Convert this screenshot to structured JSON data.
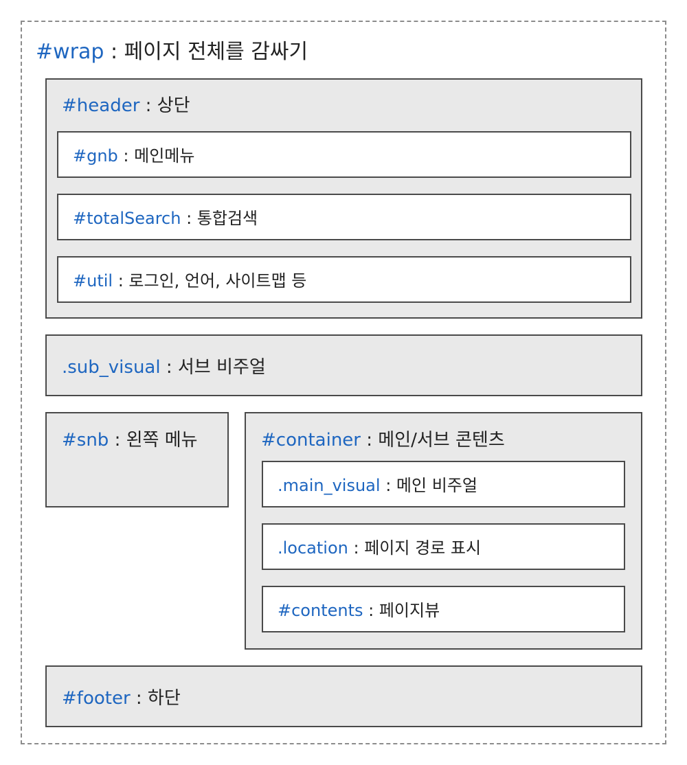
{
  "colors": {
    "selector": "#1e66c0",
    "text": "#222222",
    "section_bg": "#e9e9e9",
    "border": "#4a4a4a",
    "dashed_border": "#8c8c8c"
  },
  "wrap": {
    "selector": "#wrap",
    "desc": " : 페이지 전체를 감싸기"
  },
  "header": {
    "selector": "#header",
    "desc": " : 상단",
    "gnb": {
      "selector": "#gnb",
      "desc": " : 메인메뉴"
    },
    "totalSearch": {
      "selector": "#totalSearch",
      "desc": " : 통합검색"
    },
    "util": {
      "selector": "#util",
      "desc": " : 로그인, 언어, 사이트맵 등"
    }
  },
  "sub_visual": {
    "selector": ".sub_visual",
    "desc": " : 서브 비주얼"
  },
  "snb": {
    "selector": "#snb",
    "desc": " : 왼쪽 메뉴"
  },
  "container": {
    "selector": "#container",
    "desc": " : 메인/서브 콘텐츠",
    "main_visual": {
      "selector": ".main_visual",
      "desc": " : 메인 비주얼"
    },
    "location": {
      "selector": ".location",
      "desc": " : 페이지 경로 표시"
    },
    "contents": {
      "selector": "#contents",
      "desc": " : 페이지뷰"
    }
  },
  "footer": {
    "selector": "#footer",
    "desc": " : 하단"
  }
}
